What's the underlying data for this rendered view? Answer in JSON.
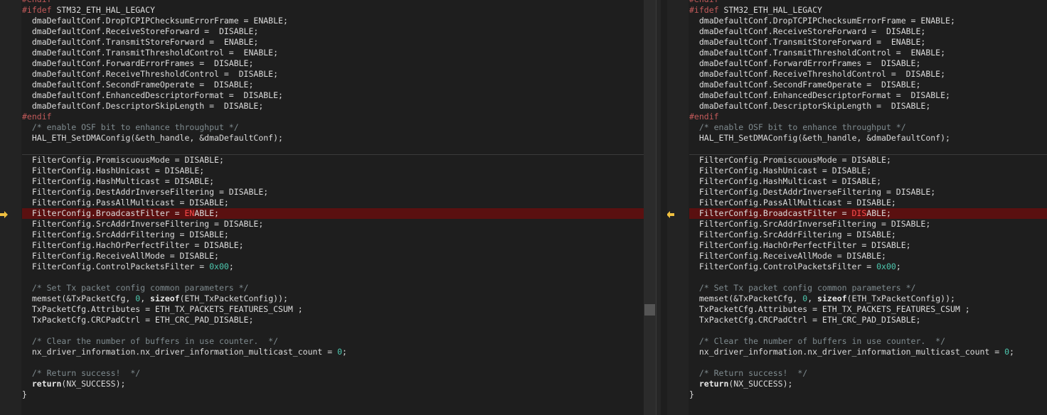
{
  "left": {
    "lines": [
      {
        "t": "#endif",
        "c": "pp"
      },
      {
        "t": "#ifdef STM32_ETH_HAL_LEGACY",
        "c": "pp2"
      },
      {
        "t": "  dmaDefaultConf.DropTCPIPChecksumErrorFrame = ENABLE;"
      },
      {
        "t": "  dmaDefaultConf.ReceiveStoreForward =  DISABLE;"
      },
      {
        "t": "  dmaDefaultConf.TransmitStoreForward =  ENABLE;"
      },
      {
        "t": "  dmaDefaultConf.TransmitThresholdControl =  ENABLE;"
      },
      {
        "t": "  dmaDefaultConf.ForwardErrorFrames =  DISABLE;"
      },
      {
        "t": "  dmaDefaultConf.ReceiveThresholdControl =  DISABLE;"
      },
      {
        "t": "  dmaDefaultConf.SecondFrameOperate =  DISABLE;"
      },
      {
        "t": "  dmaDefaultConf.EnhancedDescriptorFormat =  DISABLE;"
      },
      {
        "t": "  dmaDefaultConf.DescriptorSkipLength =  DISABLE;"
      },
      {
        "t": "#endif",
        "c": "pp"
      },
      {
        "t": "  /* enable OSF bit to enhance throughput */",
        "c": "cm"
      },
      {
        "t": "  HAL_ETH_SetDMAConfig(&eth_handle, &dmaDefaultConf);"
      },
      {
        "t": "",
        "c": "sepb"
      },
      {
        "t": "  FilterConfig.PromiscuousMode = DISABLE;"
      },
      {
        "t": "  FilterConfig.HashUnicast = DISABLE;"
      },
      {
        "t": "  FilterConfig.HashMulticast = DISABLE;"
      },
      {
        "t": "  FilterConfig.DestAddrInverseFiltering = DISABLE;"
      },
      {
        "t": "  FilterConfig.PassAllMulticast = DISABLE;"
      },
      {
        "t": "  FilterConfig.BroadcastFilter = ENABLE;",
        "c": "diff",
        "hl": "EN"
      },
      {
        "t": "  FilterConfig.SrcAddrInverseFiltering = DISABLE;"
      },
      {
        "t": "  FilterConfig.SrcAddrFiltering = DISABLE;"
      },
      {
        "t": "  FilterConfig.HachOrPerfectFilter = DISABLE;"
      },
      {
        "t": "  FilterConfig.ReceiveAllMode = DISABLE;"
      },
      {
        "t": "  FilterConfig.ControlPacketsFilter = 0x00;",
        "num": "0x00"
      },
      {
        "t": ""
      },
      {
        "t": "  /* Set Tx packet config common parameters */",
        "c": "cm"
      },
      {
        "t": "  memset(&TxPacketCfg, 0, sizeof(ETH_TxPacketConfig));",
        "memset": true
      },
      {
        "t": "  TxPacketCfg.Attributes = ETH_TX_PACKETS_FEATURES_CSUM ;"
      },
      {
        "t": "  TxPacketCfg.CRCPadCtrl = ETH_CRC_PAD_DISABLE;"
      },
      {
        "t": ""
      },
      {
        "t": "  /* Clear the number of buffers in use counter.  */",
        "c": "cm"
      },
      {
        "t": "  nx_driver_information.nx_driver_information_multicast_count = 0;",
        "num": "0"
      },
      {
        "t": ""
      },
      {
        "t": "  /* Return success!  */",
        "c": "cm"
      },
      {
        "t": "  return(NX_SUCCESS);",
        "ret": true
      },
      {
        "t": "}"
      }
    ]
  },
  "right": {
    "lines": [
      {
        "t": "#endif",
        "c": "pp"
      },
      {
        "t": "#ifdef STM32_ETH_HAL_LEGACY",
        "c": "pp2"
      },
      {
        "t": "  dmaDefaultConf.DropTCPIPChecksumErrorFrame = ENABLE;"
      },
      {
        "t": "  dmaDefaultConf.ReceiveStoreForward =  DISABLE;"
      },
      {
        "t": "  dmaDefaultConf.TransmitStoreForward =  ENABLE;"
      },
      {
        "t": "  dmaDefaultConf.TransmitThresholdControl =  ENABLE;"
      },
      {
        "t": "  dmaDefaultConf.ForwardErrorFrames =  DISABLE;"
      },
      {
        "t": "  dmaDefaultConf.ReceiveThresholdControl =  DISABLE;"
      },
      {
        "t": "  dmaDefaultConf.SecondFrameOperate =  DISABLE;"
      },
      {
        "t": "  dmaDefaultConf.EnhancedDescriptorFormat =  DISABLE;"
      },
      {
        "t": "  dmaDefaultConf.DescriptorSkipLength =  DISABLE;"
      },
      {
        "t": "#endif",
        "c": "pp"
      },
      {
        "t": "  /* enable OSF bit to enhance throughput */",
        "c": "cm"
      },
      {
        "t": "  HAL_ETH_SetDMAConfig(&eth_handle, &dmaDefaultConf);"
      },
      {
        "t": "",
        "c": "sepb"
      },
      {
        "t": "  FilterConfig.PromiscuousMode = DISABLE;"
      },
      {
        "t": "  FilterConfig.HashUnicast = DISABLE;"
      },
      {
        "t": "  FilterConfig.HashMulticast = DISABLE;"
      },
      {
        "t": "  FilterConfig.DestAddrInverseFiltering = DISABLE;"
      },
      {
        "t": "  FilterConfig.PassAllMulticast = DISABLE;"
      },
      {
        "t": "  FilterConfig.BroadcastFilter = DISABLE;",
        "c": "diff",
        "hl": "DIS"
      },
      {
        "t": "  FilterConfig.SrcAddrInverseFiltering = DISABLE;"
      },
      {
        "t": "  FilterConfig.SrcAddrFiltering = DISABLE;"
      },
      {
        "t": "  FilterConfig.HachOrPerfectFilter = DISABLE;"
      },
      {
        "t": "  FilterConfig.ReceiveAllMode = DISABLE;"
      },
      {
        "t": "  FilterConfig.ControlPacketsFilter = 0x00;",
        "num": "0x00"
      },
      {
        "t": ""
      },
      {
        "t": "  /* Set Tx packet config common parameters */",
        "c": "cm"
      },
      {
        "t": "  memset(&TxPacketCfg, 0, sizeof(ETH_TxPacketConfig));",
        "memset": true
      },
      {
        "t": "  TxPacketCfg.Attributes = ETH_TX_PACKETS_FEATURES_CSUM ;"
      },
      {
        "t": "  TxPacketCfg.CRCPadCtrl = ETH_CRC_PAD_DISABLE;"
      },
      {
        "t": ""
      },
      {
        "t": "  /* Clear the number of buffers in use counter.  */",
        "c": "cm"
      },
      {
        "t": "  nx_driver_information.nx_driver_information_multicast_count = 0;",
        "num": "0"
      },
      {
        "t": ""
      },
      {
        "t": "  /* Return success!  */",
        "c": "cm"
      },
      {
        "t": "  return(NX_SUCCESS);",
        "ret": true
      },
      {
        "t": "}"
      }
    ]
  },
  "icons": {
    "left_marker": "arrow-right-icon",
    "right_marker": "arrow-left-icon"
  },
  "colors": {
    "diff_bg": "#5a1010",
    "marker": "#f0c040"
  }
}
